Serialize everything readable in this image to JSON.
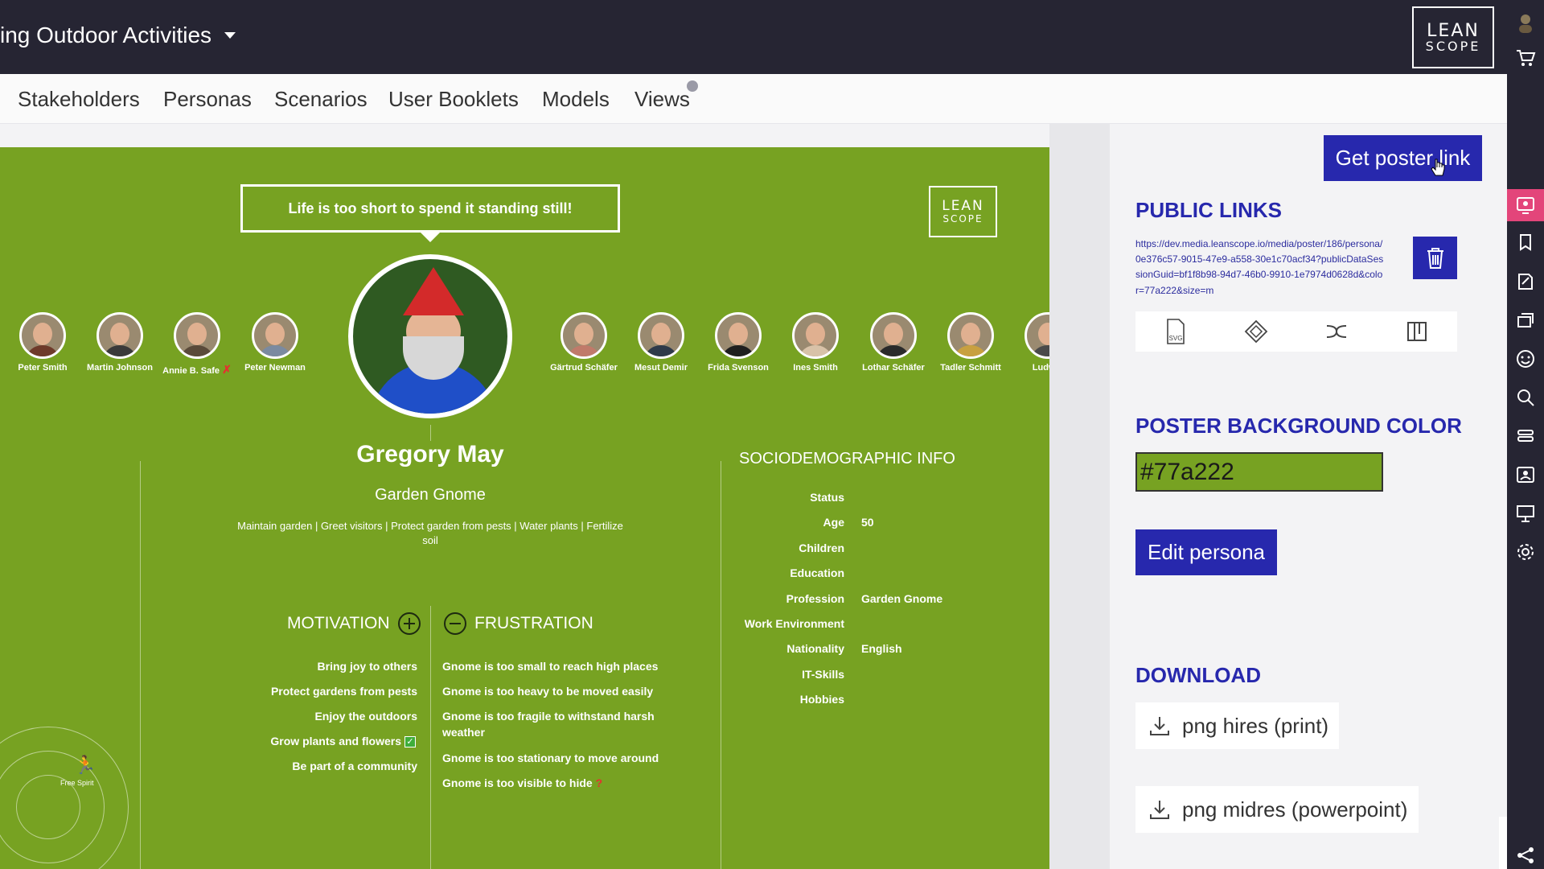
{
  "header": {
    "project_title": "ing Outdoor Activities",
    "logo_line1": "LEAN",
    "logo_line2": "SCOPE"
  },
  "tabs": [
    "Stakeholders",
    "Personas",
    "Scenarios",
    "User Booklets",
    "Models",
    "Views"
  ],
  "poster": {
    "background_color": "#77a222",
    "quote": "Life is too short to spend it standing still!",
    "logo_line1": "LEAN",
    "logo_line2": "SCOPE",
    "stakeholders": [
      {
        "name": "Peter Smith",
        "shirt": "#6e3a2a"
      },
      {
        "name": "Martin Johnson",
        "shirt": "#3a3a3a"
      },
      {
        "name": "Annie B. Safe",
        "shirt": "#5a4a3a",
        "flag": "✗"
      },
      {
        "name": "Peter Newman",
        "shirt": "#7b8aa0"
      },
      {
        "name": "Gärtrud Schäfer",
        "shirt": "#c07a6a"
      },
      {
        "name": "Mesut Demir",
        "shirt": "#2f3a4a"
      },
      {
        "name": "Frida Svenson",
        "shirt": "#1f1f1f"
      },
      {
        "name": "Ines Smith",
        "shirt": "#d8c2a8"
      },
      {
        "name": "Lothar Schäfer",
        "shirt": "#2a2a2a"
      },
      {
        "name": "Tadler Schmitt",
        "shirt": "#c8a040"
      },
      {
        "name": "Ludwig",
        "shirt": "#4a4a4a"
      }
    ],
    "persona_name": "Gregory May",
    "persona_role": "Garden Gnome",
    "persona_tasks_line1": "Maintain garden | Greet visitors | Protect garden from pests | Water plants | Fertilize",
    "persona_tasks_line2": "soil",
    "motivation_title": "MOTIVATION",
    "frustration_title": "FRUSTRATION",
    "motivations": [
      "Bring joy to others",
      "Protect gardens from pests",
      "Enjoy the outdoors",
      "Grow plants and flowers",
      "Be part of a community"
    ],
    "frustrations": [
      "Gnome is too small to reach high places",
      "Gnome is too heavy to be moved easily",
      "Gnome is too fragile to withstand harsh weather",
      "Gnome is too stationary to move around",
      "Gnome is too visible to hide"
    ],
    "socio_title": "SOCIODEMOGRAPHIC INFO",
    "socio": [
      {
        "label": "Status",
        "value": ""
      },
      {
        "label": "Age",
        "value": "50"
      },
      {
        "label": "Children",
        "value": ""
      },
      {
        "label": "Education",
        "value": ""
      },
      {
        "label": "Profession",
        "value": "Garden Gnome"
      },
      {
        "label": "Work Environment",
        "value": ""
      },
      {
        "label": "Nationality",
        "value": "English"
      },
      {
        "label": "IT-Skills",
        "value": ""
      },
      {
        "label": "Hobbies",
        "value": ""
      }
    ],
    "archetype_label": "Free Spirit"
  },
  "panel": {
    "get_link_label": "Get poster link",
    "public_links_title": "PUBLIC LINKS",
    "public_link": "https://dev.media.leanscope.io/media/poster/186/persona/0e376c57-9015-47e9-a558-30e1c70acf34?publicDataSessionGuid=bf1f8b98-94d7-46b0-9910-1e7974d0628d&color=77a222&size=m",
    "svg_label": "SVG",
    "bg_color_title": "POSTER BACKGROUND COLOR",
    "bg_color_value": "#77a222",
    "edit_label": "Edit persona",
    "download_title": "DOWNLOAD",
    "download_hires": "png hires (print)",
    "download_midres": "png midres (powerpoint)"
  },
  "colors": {
    "accent": "#2728ad",
    "sidebar_active": "#e3457a",
    "header_bg": "#262533"
  }
}
